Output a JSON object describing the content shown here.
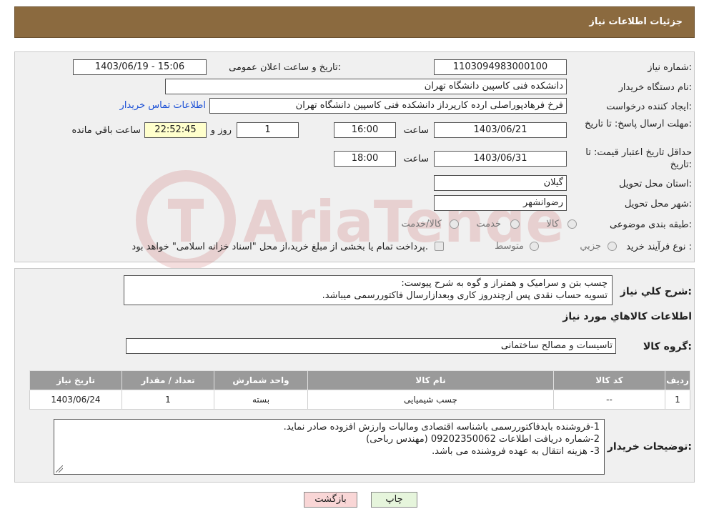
{
  "header": {
    "title": "جزئیات اطلاعات نیاز"
  },
  "form": {
    "need_number_label": "شماره نیاز:",
    "need_number": "1103094983000100",
    "announce_label": "تاریخ و ساعت اعلان عمومی:",
    "announce_value": "1403/06/19 - 15:06",
    "buyer_org_label": "نام دستگاه خریدار:",
    "buyer_org": "دانشکده فنی کاسپین دانشگاه تهران",
    "creator_label": "ایجاد کننده درخواست:",
    "creator": "فرخ فرهادپوراصلی ارده کارپرداز دانشکده فنی کاسپین دانشگاه تهران",
    "contact_link": "اطلاعات تماس خریدار",
    "deadline_label": "مهلت ارسال پاسخ: تا تاریخ:",
    "deadline_date": "1403/06/21",
    "time_label": "ساعت",
    "deadline_time": "16:00",
    "days_value": "1",
    "days_label": "روز و",
    "remaining_time": "22:52:45",
    "remaining_label": "ساعت باقي مانده",
    "validity_label": "حداقل تاریخ اعتبار قیمت: تا تاریخ:",
    "validity_date": "1403/06/31",
    "validity_time": "18:00",
    "province_label": "استان محل تحویل:",
    "province": "گیلان",
    "city_label": "شهر محل تحویل:",
    "city": "رضوانشهر",
    "category_label": "طبقه بندی موضوعی:",
    "category_options": [
      "کالا",
      "خدمت",
      "کالا/خدمت"
    ],
    "process_label": "نوع فرآیند خرید :",
    "process_options": [
      "جزيي",
      "متوسط"
    ],
    "payment_note": "پرداخت تمام یا بخشی از مبلغ خرید،از محل \"اسناد خزانه اسلامی\" خواهد بود."
  },
  "details": {
    "description_label": "شرح كلي نياز:",
    "description_lines": [
      "چسب بتن و سرامیک و همتراز و گوه به شرح پیوست:",
      "تسویه حساب نقدی پس ازچندروز کاری وبعدازارسال فاکتوررسمی میباشد."
    ],
    "goods_info_title": "اطلاعات كالاهاي مورد نياز",
    "goods_group_label": "گروه كالا:",
    "goods_group": "تاسیسات و مصالح ساختمانی",
    "table_headers": [
      "رديف",
      "كد كالا",
      "نام كالا",
      "واحد شمارش",
      "تعداد / مقدار",
      "تاريخ نياز"
    ],
    "table_rows": [
      [
        "1",
        "--",
        "چسب شیمیایی",
        "بسته",
        "1",
        "1403/06/24"
      ]
    ],
    "buyer_notes_label": "توضيحات خريدار:",
    "buyer_notes_lines": [
      "1-فروشنده بایدفاکتوررسمی باشناسه اقتصادی ومالیات وارزش افزوده صادر نماید.",
      "2-شماره دریافت اطلاعات 09202350062 (مهندس رباحی)",
      "3- هزینه انتقال به عهده فروشنده می باشد."
    ]
  },
  "buttons": {
    "print": "چاپ",
    "back": "بازگشت"
  },
  "watermark_text": "AriaTender.neT",
  "colors": {
    "header_bg": "#8b6a3f",
    "link": "#1a4fd6",
    "back_btn": "#f9d6d6",
    "print_btn": "#e6f5dc"
  }
}
